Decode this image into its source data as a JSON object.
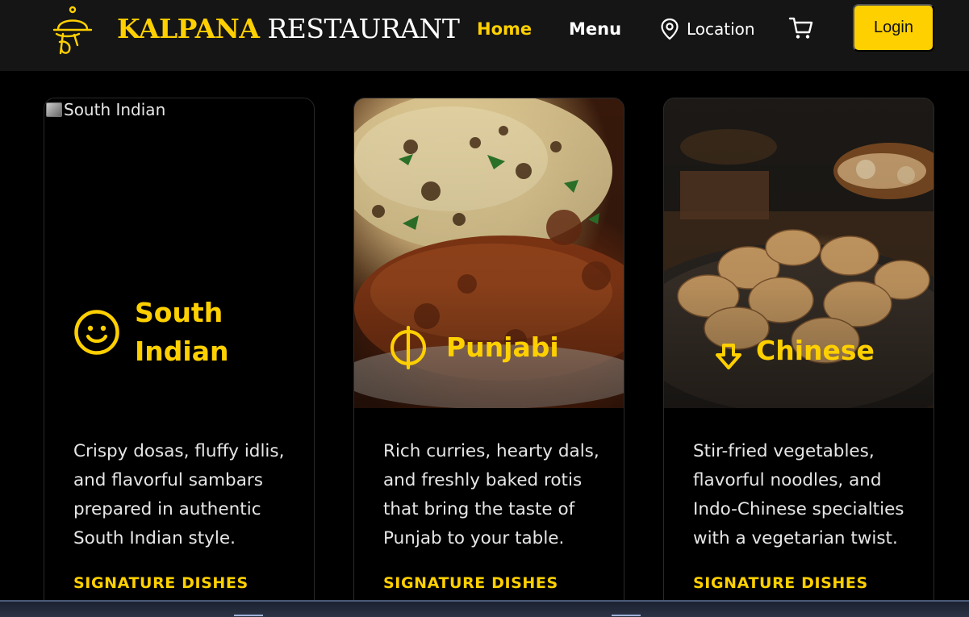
{
  "header": {
    "brand_part1": "KALPANA",
    "brand_part2": "RESTAURANT",
    "nav": {
      "home": "Home",
      "menu": "Menu",
      "location": "Location"
    },
    "login_label": "Login",
    "icons": {
      "logo": "chef-cloche-icon",
      "location": "map-pin-icon",
      "cart": "cart-icon"
    }
  },
  "cards": [
    {
      "image_alt": "South Indian",
      "image_broken": true,
      "icon": "smile-icon",
      "title_line1": "South",
      "title_line2": "Indian",
      "description": "Crispy dosas, fluffy idlis, and flavorful sambars prepared in authentic South Indian style.",
      "section_label": "SIGNATURE DISHES"
    },
    {
      "icon": "khanda-icon",
      "title": "Punjabi",
      "description": "Rich curries, hearty dals, and freshly baked rotis that bring the taste of Punjab to your table.",
      "section_label": "SIGNATURE DISHES"
    },
    {
      "icon": "arrow-down-icon",
      "title": "Chinese",
      "description": "Stir-fried vegetables, flavorful noodles, and Indo-Chinese specialties with a vegetarian twist.",
      "section_label": "SIGNATURE DISHES"
    }
  ],
  "colors": {
    "accent": "#FFD000",
    "background": "#000000",
    "nav_background": "#151515"
  }
}
